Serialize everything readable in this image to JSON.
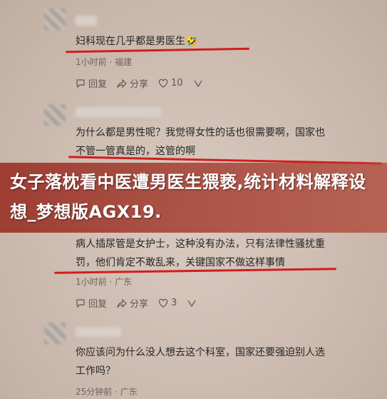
{
  "comments": [
    {
      "text_lines": [
        "妇科现在几乎都是男医生🤣"
      ],
      "time_location": "1小时前 · 福建",
      "reply_label": "回复",
      "share_label": "分享",
      "like_count": "10"
    },
    {
      "text_lines": [
        "为什么都是男性呢？我觉得女性的话也很需要啊，国家也",
        "不管一管真是的，这管的啊"
      ]
    },
    {
      "text_lines": [
        "病人插尿管是女护士，这种没有办法，只有法律性骚扰重",
        "罚，他们肯定不敢乱来，关键国家不做这样事情"
      ],
      "time_location": "1小时前 · 广东",
      "reply_label": "回复",
      "share_label": "分享",
      "like_count": "3"
    },
    {
      "text_lines": [
        "你应该问为什么没人想去这个科室，国家还要强迫别人选",
        "工作吗？"
      ],
      "time_location": "25分钟前 · 广东"
    }
  ],
  "banner": {
    "title": "女子落枕看中医遭男医生猥亵,统计材料解释设想_梦想版AGX19."
  },
  "colors": {
    "underline": "#d21d1d",
    "banner": "#9a2a1e"
  }
}
